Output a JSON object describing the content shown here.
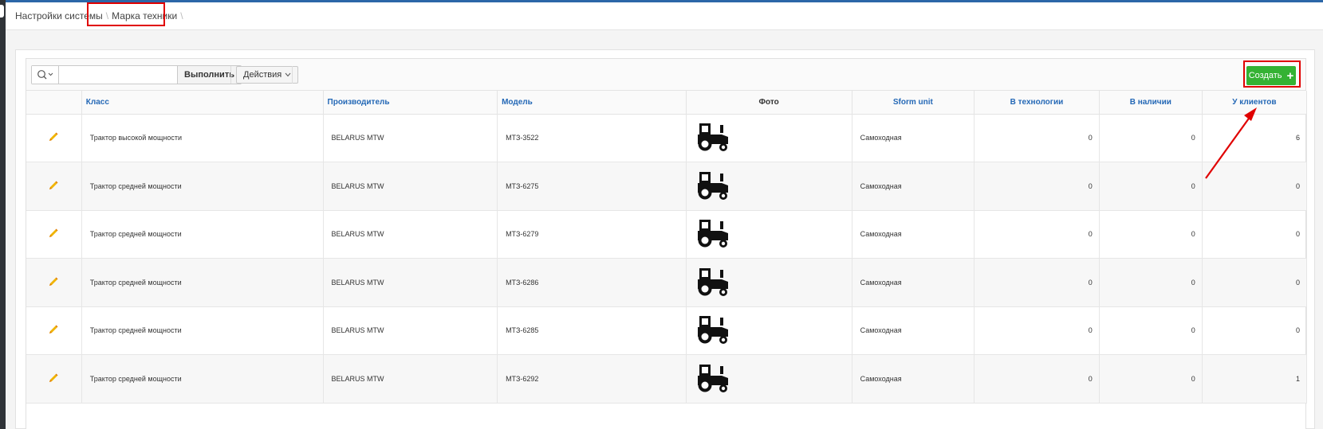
{
  "breadcrumb": {
    "parent": "Настройки системы",
    "separator": "\\",
    "current": "Марка техники",
    "trail_separator": "\\"
  },
  "toolbar": {
    "search_icon": "search-icon",
    "search_value": "",
    "go_label": "Выполнить",
    "actions_label": "Действия",
    "create_label": "Создать",
    "create_color": "#34b233"
  },
  "table": {
    "headers": {
      "edit": "",
      "class": "Класс",
      "manufacturer": "Производитель",
      "model": "Модель",
      "photo": "Фото",
      "sform": "Sform unit",
      "in_tech": "В технологии",
      "in_stock": "В наличии",
      "clients": "У клиентов"
    },
    "rows": [
      {
        "class": "Трактор высокой мощности",
        "manufacturer": "BELARUS MTW",
        "model": "МТЗ-3522",
        "photo": "tractor-icon",
        "sform": "Самоходная",
        "in_tech": "0",
        "in_stock": "0",
        "clients": "6"
      },
      {
        "class": "Трактор средней мощности",
        "manufacturer": "BELARUS MTW",
        "model": "МТЗ-6275",
        "photo": "tractor-icon",
        "sform": "Самоходная",
        "in_tech": "0",
        "in_stock": "0",
        "clients": "0"
      },
      {
        "class": "Трактор средней мощности",
        "manufacturer": "BELARUS MTW",
        "model": "МТЗ-6279",
        "photo": "tractor-icon",
        "sform": "Самоходная",
        "in_tech": "0",
        "in_stock": "0",
        "clients": "0"
      },
      {
        "class": "Трактор средней мощности",
        "manufacturer": "BELARUS MTW",
        "model": "МТЗ-6286",
        "photo": "tractor-icon",
        "sform": "Самоходная",
        "in_tech": "0",
        "in_stock": "0",
        "clients": "0"
      },
      {
        "class": "Трактор средней мощности",
        "manufacturer": "BELARUS MTW",
        "model": "МТЗ-6285",
        "photo": "tractor-icon",
        "sform": "Самоходная",
        "in_tech": "0",
        "in_stock": "0",
        "clients": "0"
      },
      {
        "class": "Трактор средней мощности",
        "manufacturer": "BELARUS MTW",
        "model": "МТЗ-6292",
        "photo": "tractor-icon",
        "sform": "Самоходная",
        "in_tech": "0",
        "in_stock": "0",
        "clients": "1"
      }
    ]
  },
  "annotation": {
    "highlight_color": "#e00000"
  }
}
